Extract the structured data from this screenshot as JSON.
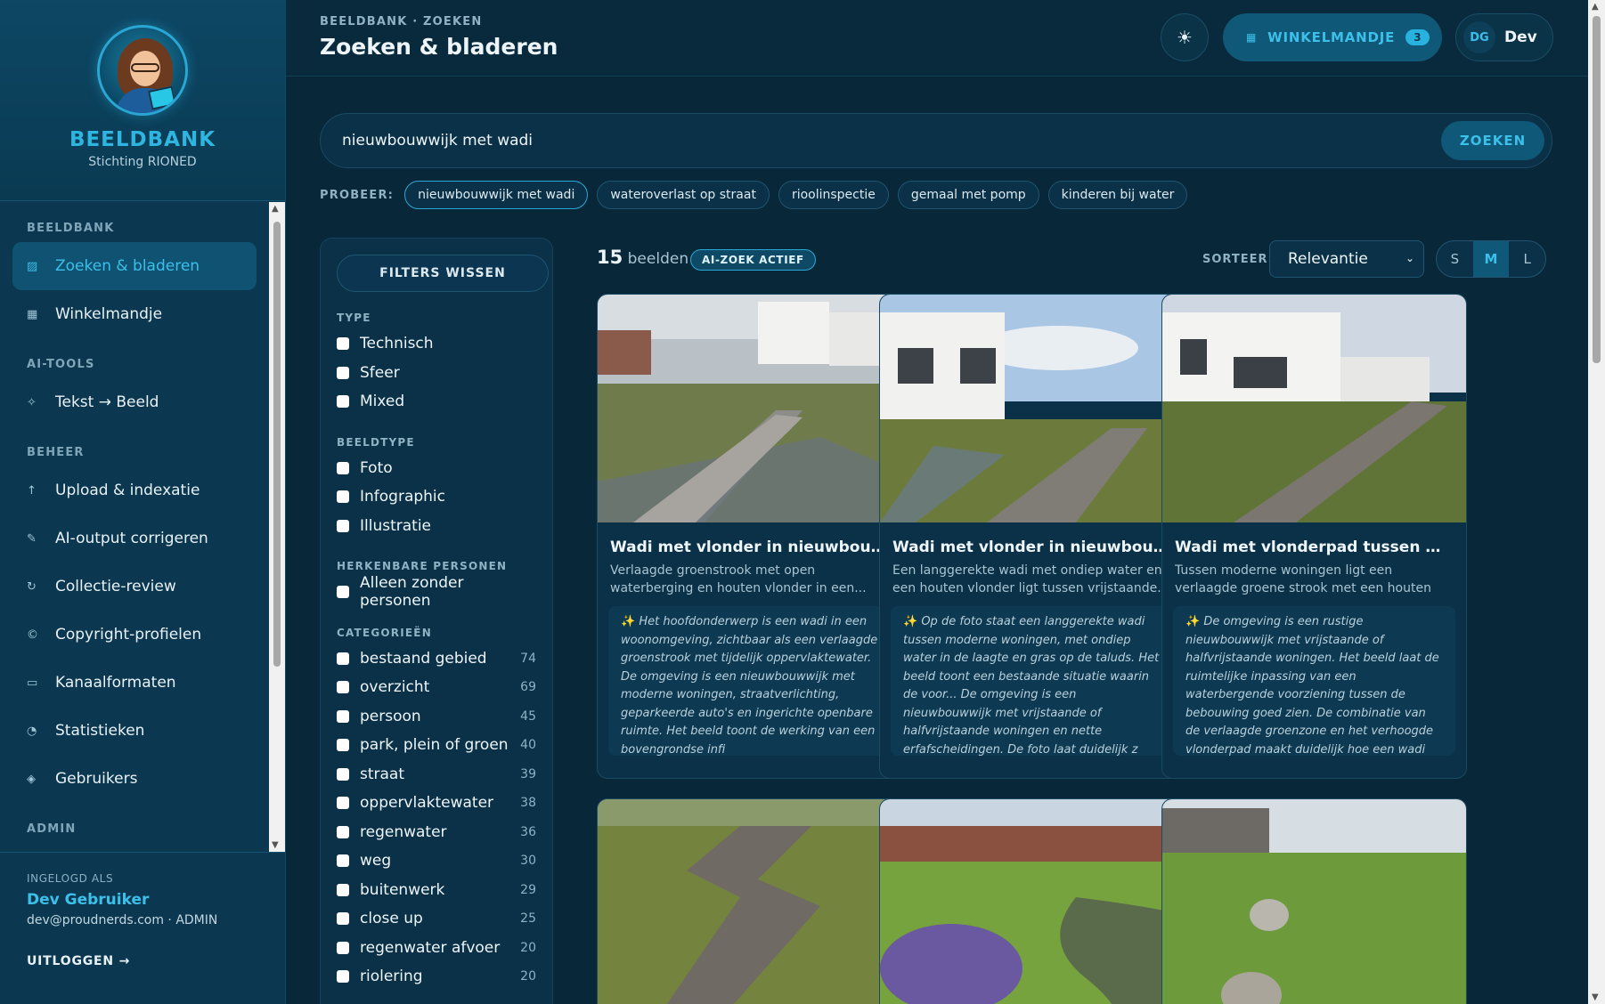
{
  "brand": {
    "title": "BEELDBANK",
    "subtitle": "Stichting RIONED"
  },
  "nav": {
    "sections": [
      {
        "label": "BEELDBANK",
        "items": [
          {
            "label": "Zoeken & bladeren",
            "icon": "search-grid-icon",
            "glyph": "▨",
            "active": true
          },
          {
            "label": "Winkelmandje",
            "icon": "cart-icon",
            "glyph": "▦",
            "active": false
          }
        ]
      },
      {
        "label": "AI-TOOLS",
        "items": [
          {
            "label": "Tekst → Beeld",
            "icon": "sparkle-icon",
            "glyph": "✧",
            "active": false
          }
        ]
      },
      {
        "label": "BEHEER",
        "items": [
          {
            "label": "Upload & indexatie",
            "icon": "upload-icon",
            "glyph": "↑",
            "active": false
          },
          {
            "label": "AI-output corrigeren",
            "icon": "pencil-icon",
            "glyph": "✎",
            "active": false
          },
          {
            "label": "Collectie-review",
            "icon": "refresh-icon",
            "glyph": "↻",
            "active": false
          },
          {
            "label": "Copyright-profielen",
            "icon": "copyright-icon",
            "glyph": "©",
            "active": false
          },
          {
            "label": "Kanaalformaten",
            "icon": "frame-icon",
            "glyph": "▭",
            "active": false
          },
          {
            "label": "Statistieken",
            "icon": "chart-pie-icon",
            "glyph": "◔",
            "active": false
          },
          {
            "label": "Gebruikers",
            "icon": "users-icon",
            "glyph": "◈",
            "active": false
          }
        ]
      },
      {
        "label": "ADMIN",
        "items": []
      }
    ]
  },
  "account": {
    "label": "INGELOGD ALS",
    "name": "Dev Gebruiker",
    "meta": "dev@proudnerds.com · ADMIN",
    "logout": "UITLOGGEN →"
  },
  "header": {
    "breadcrumb": "BEELDBANK · ZOEKEN",
    "title": "Zoeken & bladeren",
    "theme_icon": "sun-icon",
    "theme_glyph": "☀",
    "cart_label": "WINKELMANDJE",
    "cart_count": "3",
    "user_initials": "DG",
    "user_name": "Dev"
  },
  "search": {
    "value": "nieuwbouwwijk met wadi",
    "button": "ZOEKEN",
    "try_label": "PROBEER:",
    "suggestions": [
      "nieuwbouwwijk met wadi",
      "wateroverlast op straat",
      "rioolinspectie",
      "gemaal met pomp",
      "kinderen bij water"
    ]
  },
  "filters": {
    "clear": "FILTERS WISSEN",
    "type_label": "TYPE",
    "types": [
      "Technisch",
      "Sfeer",
      "Mixed"
    ],
    "beeldtype_label": "BEELDTYPE",
    "beeldtypes": [
      "Foto",
      "Infographic",
      "Illustratie"
    ],
    "personen_label": "HERKENBARE PERSONEN",
    "personen": [
      "Alleen zonder personen"
    ],
    "categorieen_label": "CATEGORIEËN",
    "categorieen": [
      {
        "label": "bestaand gebied",
        "count": "74"
      },
      {
        "label": "overzicht",
        "count": "69"
      },
      {
        "label": "persoon",
        "count": "45"
      },
      {
        "label": "park, plein of groen",
        "count": "40"
      },
      {
        "label": "straat",
        "count": "39"
      },
      {
        "label": "oppervlaktewater",
        "count": "38"
      },
      {
        "label": "regenwater",
        "count": "36"
      },
      {
        "label": "weg",
        "count": "30"
      },
      {
        "label": "buitenwerk",
        "count": "29"
      },
      {
        "label": "close up",
        "count": "25"
      },
      {
        "label": "regenwater afvoer",
        "count": "20"
      },
      {
        "label": "riolering",
        "count": "20"
      }
    ]
  },
  "results": {
    "count": "15",
    "count_label": "beelden",
    "ai_badge": "AI-ZOEK ACTIEF",
    "sort_label": "SORTEER:",
    "sort_value": "Relevantie",
    "sizes": [
      "S",
      "M",
      "L"
    ],
    "active_size": "M"
  },
  "cards": [
    {
      "title": "Wadi met vlonder in nieuwbouwwijk",
      "desc": "Verlaagde groenstrook met open waterberging en houten vlonder in een...",
      "ai": "Het hoofdonderwerp is een wadi in een woonomgeving, zichtbaar als een verlaagde groenstrook met tijdelijk oppervlaktewater. De omgeving is een nieuwbouwwijk met moderne woningen, straatverlichting, geparkeerde auto's en ingerichte openbare ruimte. Het beeld toont de werking van een bovengrondse infi"
    },
    {
      "title": "Wadi met vlonder in nieuwbouwwijk",
      "desc": "Een langgerekte wadi met ondiep water en een houten vlonder ligt tussen vrijstaande...",
      "ai": "Op de foto staat een langgerekte wadi tussen moderne woningen, met ondiep water in de laagte en gras op de taluds. Het beeld toont een bestaande situatie waarin de voor... De omgeving is een nieuwbouwwijk met vrijstaande of halfvrijstaande woningen en nette erfafscheidingen. De foto laat duidelijk z"
    },
    {
      "title": "Wadi met vlonderpad tussen woning...",
      "desc": "Tussen moderne woningen ligt een verlaagde groene strook met een houten vlonderpad,...",
      "ai": "De omgeving is een rustige nieuwbouwwijk met vrijstaande of halfvrijstaande woningen. Het beeld laat de ruimtelijke inpassing van een waterbergende voorziening tussen de bebouwing goed zien. De combinatie van de verlaagde groenzone en het verhoogde vlonderpad maakt duidelijk hoe een wadi toega... De"
    },
    {
      "title": "",
      "desc": "",
      "ai": ""
    },
    {
      "title": "",
      "desc": "",
      "ai": ""
    },
    {
      "title": "",
      "desc": "",
      "ai": ""
    }
  ]
}
